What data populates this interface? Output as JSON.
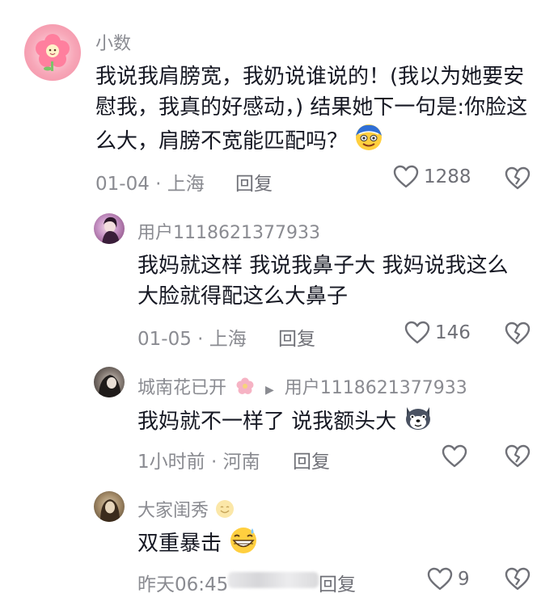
{
  "comments": [
    {
      "author": "小数",
      "text": "我说我肩膀宽，我奶说谁说的！(我以为她要安慰我，我真的好感动，) 结果她下一句是:你脸这么大，肩膀不宽能匹配吗？",
      "time_location": "01-04 · 上海",
      "reply_label": "回复",
      "likes": "1288"
    }
  ],
  "replies": [
    {
      "author": "用户1118621377933",
      "text": "我妈就这样 我说我鼻子大 我妈说我这么大脸就得配这么大鼻子",
      "time_location": "01-05 · 上海",
      "reply_label": "回复",
      "likes": "146"
    },
    {
      "author": "城南花已开",
      "reply_to": "用户1118621377933",
      "text": "我妈就不一样了 说我额头大",
      "time_location": "1小时前 · 河南",
      "reply_label": "回复",
      "likes": ""
    },
    {
      "author": "大家闺秀",
      "text": "双重暴击",
      "time_location": "昨天06:45",
      "reply_label": "回复",
      "likes": "9"
    }
  ],
  "colors": {
    "primary_text": "#161823",
    "secondary_text": "#8a8b91",
    "background": "#ffffff"
  },
  "icons": {
    "like": "heart-outline-icon",
    "dislike": "broken-heart-icon"
  }
}
